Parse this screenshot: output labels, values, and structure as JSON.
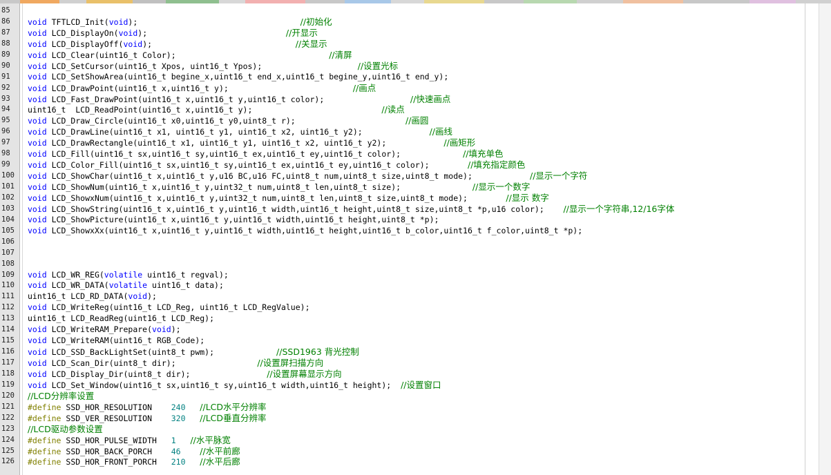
{
  "editor": {
    "lines": [
      {
        "n": "85",
        "t": []
      },
      {
        "n": "86",
        "t": [
          [
            "kw",
            "void"
          ],
          [
            "tx",
            " TFTLCD_Init("
          ],
          [
            "kw",
            "void"
          ],
          [
            "tx",
            ");                                  "
          ],
          [
            "cm",
            "//初始化"
          ]
        ]
      },
      {
        "n": "87",
        "t": [
          [
            "kw",
            "void"
          ],
          [
            "tx",
            " LCD_DisplayOn("
          ],
          [
            "kw",
            "void"
          ],
          [
            "tx",
            ");                             "
          ],
          [
            "cm",
            "//开显示"
          ]
        ]
      },
      {
        "n": "88",
        "t": [
          [
            "kw",
            "void"
          ],
          [
            "tx",
            " LCD_DisplayOff("
          ],
          [
            "kw",
            "void"
          ],
          [
            "tx",
            ");                              "
          ],
          [
            "cm",
            "//关显示"
          ]
        ]
      },
      {
        "n": "89",
        "t": [
          [
            "kw",
            "void"
          ],
          [
            "tx",
            " LCD_Clear(uint16_t Color);                                "
          ],
          [
            "cm",
            "//清屏"
          ]
        ]
      },
      {
        "n": "90",
        "t": [
          [
            "kw",
            "void"
          ],
          [
            "tx",
            " LCD_SetCursor(uint16_t Xpos, uint16_t Ypos);                    "
          ],
          [
            "cm",
            "//设置光标"
          ]
        ]
      },
      {
        "n": "91",
        "t": [
          [
            "kw",
            "void"
          ],
          [
            "tx",
            " LCD_SetShowArea(uint16_t begine_x,uint16_t end_x,uint16_t begine_y,uint16_t end_y);"
          ]
        ]
      },
      {
        "n": "92",
        "t": [
          [
            "kw",
            "void"
          ],
          [
            "tx",
            " LCD_DrawPoint(uint16_t x,uint16_t y);                          "
          ],
          [
            "cm",
            "//画点"
          ]
        ]
      },
      {
        "n": "93",
        "t": [
          [
            "kw",
            "void"
          ],
          [
            "tx",
            " LCD_Fast_DrawPoint(uint16_t x,uint16_t y,uint16_t color);                  "
          ],
          [
            "cm",
            "//快速画点"
          ]
        ]
      },
      {
        "n": "94",
        "t": [
          [
            "tx",
            "uint16_t  LCD_ReadPoint(uint16_t x,uint16_t y);                           "
          ],
          [
            "cm",
            "//读点"
          ]
        ]
      },
      {
        "n": "95",
        "t": [
          [
            "kw",
            "void"
          ],
          [
            "tx",
            " LCD_Draw_Circle(uint16_t x0,uint16_t y0,uint8_t r);                       "
          ],
          [
            "cm",
            "//画圆"
          ]
        ]
      },
      {
        "n": "96",
        "t": [
          [
            "kw",
            "void"
          ],
          [
            "tx",
            " LCD_DrawLine(uint16_t x1, uint16_t y1, uint16_t x2, uint16_t y2);              "
          ],
          [
            "cm",
            "//画线"
          ]
        ]
      },
      {
        "n": "97",
        "t": [
          [
            "kw",
            "void"
          ],
          [
            "tx",
            " LCD_DrawRectangle(uint16_t x1, uint16_t y1, uint16_t x2, uint16_t y2);            "
          ],
          [
            "cm",
            "//画矩形"
          ]
        ]
      },
      {
        "n": "98",
        "t": [
          [
            "kw",
            "void"
          ],
          [
            "tx",
            " LCD_Fill(uint16_t sx,uint16_t sy,uint16_t ex,uint16_t ey,uint16_t color);             "
          ],
          [
            "cm",
            "//填充单色"
          ]
        ]
      },
      {
        "n": "99",
        "t": [
          [
            "kw",
            "void"
          ],
          [
            "tx",
            " LCD_Color_Fill(uint16_t sx,uint16_t sy,uint16_t ex,uint16_t ey,uint16_t color);        "
          ],
          [
            "cm",
            "//填充指定颜色"
          ]
        ]
      },
      {
        "n": "100",
        "t": [
          [
            "kw",
            "void"
          ],
          [
            "tx",
            " LCD_ShowChar(uint16_t x,uint16_t y,u16 BC,u16 FC,uint8_t num,uint8_t size,uint8_t mode);            "
          ],
          [
            "cm",
            "//显示一个字符"
          ]
        ]
      },
      {
        "n": "101",
        "t": [
          [
            "kw",
            "void"
          ],
          [
            "tx",
            " LCD_ShowNum(uint16_t x,uint16_t y,uint32_t num,uint8_t len,uint8_t size);               "
          ],
          [
            "cm",
            "//显示一个数字"
          ]
        ]
      },
      {
        "n": "102",
        "t": [
          [
            "kw",
            "void"
          ],
          [
            "tx",
            " LCD_ShowxNum(uint16_t x,uint16_t y,uint32_t num,uint8_t len,uint8_t size,uint8_t mode);        "
          ],
          [
            "cm",
            "//显示 数字"
          ]
        ]
      },
      {
        "n": "103",
        "t": [
          [
            "kw",
            "void"
          ],
          [
            "tx",
            " LCD_ShowString(uint16_t x,uint16_t y,uint16_t width,uint16_t height,uint8_t size,uint8_t *p,u16 color);    "
          ],
          [
            "cm",
            "//显示一个字符串,12/16字体"
          ]
        ]
      },
      {
        "n": "104",
        "t": [
          [
            "kw",
            "void"
          ],
          [
            "tx",
            " LCD_ShowPicture(uint16_t x,uint16_t y,uint16_t width,uint16_t height,uint8_t *p);"
          ]
        ]
      },
      {
        "n": "105",
        "t": [
          [
            "kw",
            "void"
          ],
          [
            "tx",
            " LCD_ShowxXx(uint16_t x,uint16_t y,uint16_t width,uint16_t height,uint16_t b_color,uint16_t f_color,uint8_t *p);"
          ]
        ]
      },
      {
        "n": "106",
        "t": []
      },
      {
        "n": "107",
        "t": []
      },
      {
        "n": "108",
        "t": []
      },
      {
        "n": "109",
        "t": [
          [
            "kw",
            "void"
          ],
          [
            "tx",
            " LCD_WR_REG("
          ],
          [
            "kw",
            "volatile"
          ],
          [
            "tx",
            " uint16_t regval);"
          ]
        ]
      },
      {
        "n": "110",
        "t": [
          [
            "kw",
            "void"
          ],
          [
            "tx",
            " LCD_WR_DATA("
          ],
          [
            "kw",
            "volatile"
          ],
          [
            "tx",
            " uint16_t data);"
          ]
        ]
      },
      {
        "n": "111",
        "t": [
          [
            "tx",
            "uint16_t LCD_RD_DATA("
          ],
          [
            "kw",
            "void"
          ],
          [
            "tx",
            ");"
          ]
        ]
      },
      {
        "n": "112",
        "t": [
          [
            "kw",
            "void"
          ],
          [
            "tx",
            " LCD_WriteReg(uint16_t LCD_Reg, uint16_t LCD_RegValue);"
          ]
        ]
      },
      {
        "n": "113",
        "t": [
          [
            "tx",
            "uint16_t LCD_ReadReg(uint16_t LCD_Reg);"
          ]
        ]
      },
      {
        "n": "114",
        "t": [
          [
            "kw",
            "void"
          ],
          [
            "tx",
            " LCD_WriteRAM_Prepare("
          ],
          [
            "kw",
            "void"
          ],
          [
            "tx",
            ");"
          ]
        ]
      },
      {
        "n": "115",
        "t": [
          [
            "kw",
            "void"
          ],
          [
            "tx",
            " LCD_WriteRAM(uint16_t RGB_Code);"
          ]
        ]
      },
      {
        "n": "116",
        "t": [
          [
            "kw",
            "void"
          ],
          [
            "tx",
            " LCD_SSD_BackLightSet(uint8_t pwm);             "
          ],
          [
            "cm",
            "//SSD1963 背光控制"
          ]
        ]
      },
      {
        "n": "117",
        "t": [
          [
            "kw",
            "void"
          ],
          [
            "tx",
            " LCD_Scan_Dir(uint8_t dir);                 "
          ],
          [
            "cm",
            "//设置屏扫描方向"
          ]
        ]
      },
      {
        "n": "118",
        "t": [
          [
            "kw",
            "void"
          ],
          [
            "tx",
            " LCD_Display_Dir(uint8_t dir);                "
          ],
          [
            "cm",
            "//设置屏幕显示方向"
          ]
        ]
      },
      {
        "n": "119",
        "t": [
          [
            "kw",
            "void"
          ],
          [
            "tx",
            " LCD_Set_Window(uint16_t sx,uint16_t sy,uint16_t width,uint16_t height);  "
          ],
          [
            "cm",
            "//设置窗口"
          ]
        ]
      },
      {
        "n": "120",
        "t": [
          [
            "cm",
            "//LCD分辨率设置"
          ]
        ]
      },
      {
        "n": "121",
        "t": [
          [
            "pp",
            "#define"
          ],
          [
            "tx",
            " SSD_HOR_RESOLUTION    "
          ],
          [
            "nm",
            "240"
          ],
          [
            "tx",
            "   "
          ],
          [
            "cm",
            "//LCD水平分辨率"
          ]
        ]
      },
      {
        "n": "122",
        "t": [
          [
            "pp",
            "#define"
          ],
          [
            "tx",
            " SSD_VER_RESOLUTION    "
          ],
          [
            "nm",
            "320"
          ],
          [
            "tx",
            "   "
          ],
          [
            "cm",
            "//LCD垂直分辨率"
          ]
        ]
      },
      {
        "n": "123",
        "t": [
          [
            "cm",
            "//LCD驱动参数设置"
          ]
        ]
      },
      {
        "n": "124",
        "t": [
          [
            "pp",
            "#define"
          ],
          [
            "tx",
            " SSD_HOR_PULSE_WIDTH   "
          ],
          [
            "nm",
            "1"
          ],
          [
            "tx",
            "   "
          ],
          [
            "cm",
            "//水平脉宽"
          ]
        ]
      },
      {
        "n": "125",
        "t": [
          [
            "pp",
            "#define"
          ],
          [
            "tx",
            " SSD_HOR_BACK_PORCH    "
          ],
          [
            "nm",
            "46"
          ],
          [
            "tx",
            "    "
          ],
          [
            "cm",
            "//水平前廊"
          ]
        ]
      },
      {
        "n": "126",
        "t": [
          [
            "pp",
            "#define"
          ],
          [
            "tx",
            " SSD_HOR_FRONT_PORCH   "
          ],
          [
            "nm",
            "210"
          ],
          [
            "tx",
            "   "
          ],
          [
            "cm",
            "//水平后廊"
          ]
        ]
      }
    ]
  },
  "colors": {
    "keyword": "#0000ff",
    "comment": "#008000",
    "preprocessor": "#808000",
    "number": "#008080",
    "text": "#000000"
  }
}
